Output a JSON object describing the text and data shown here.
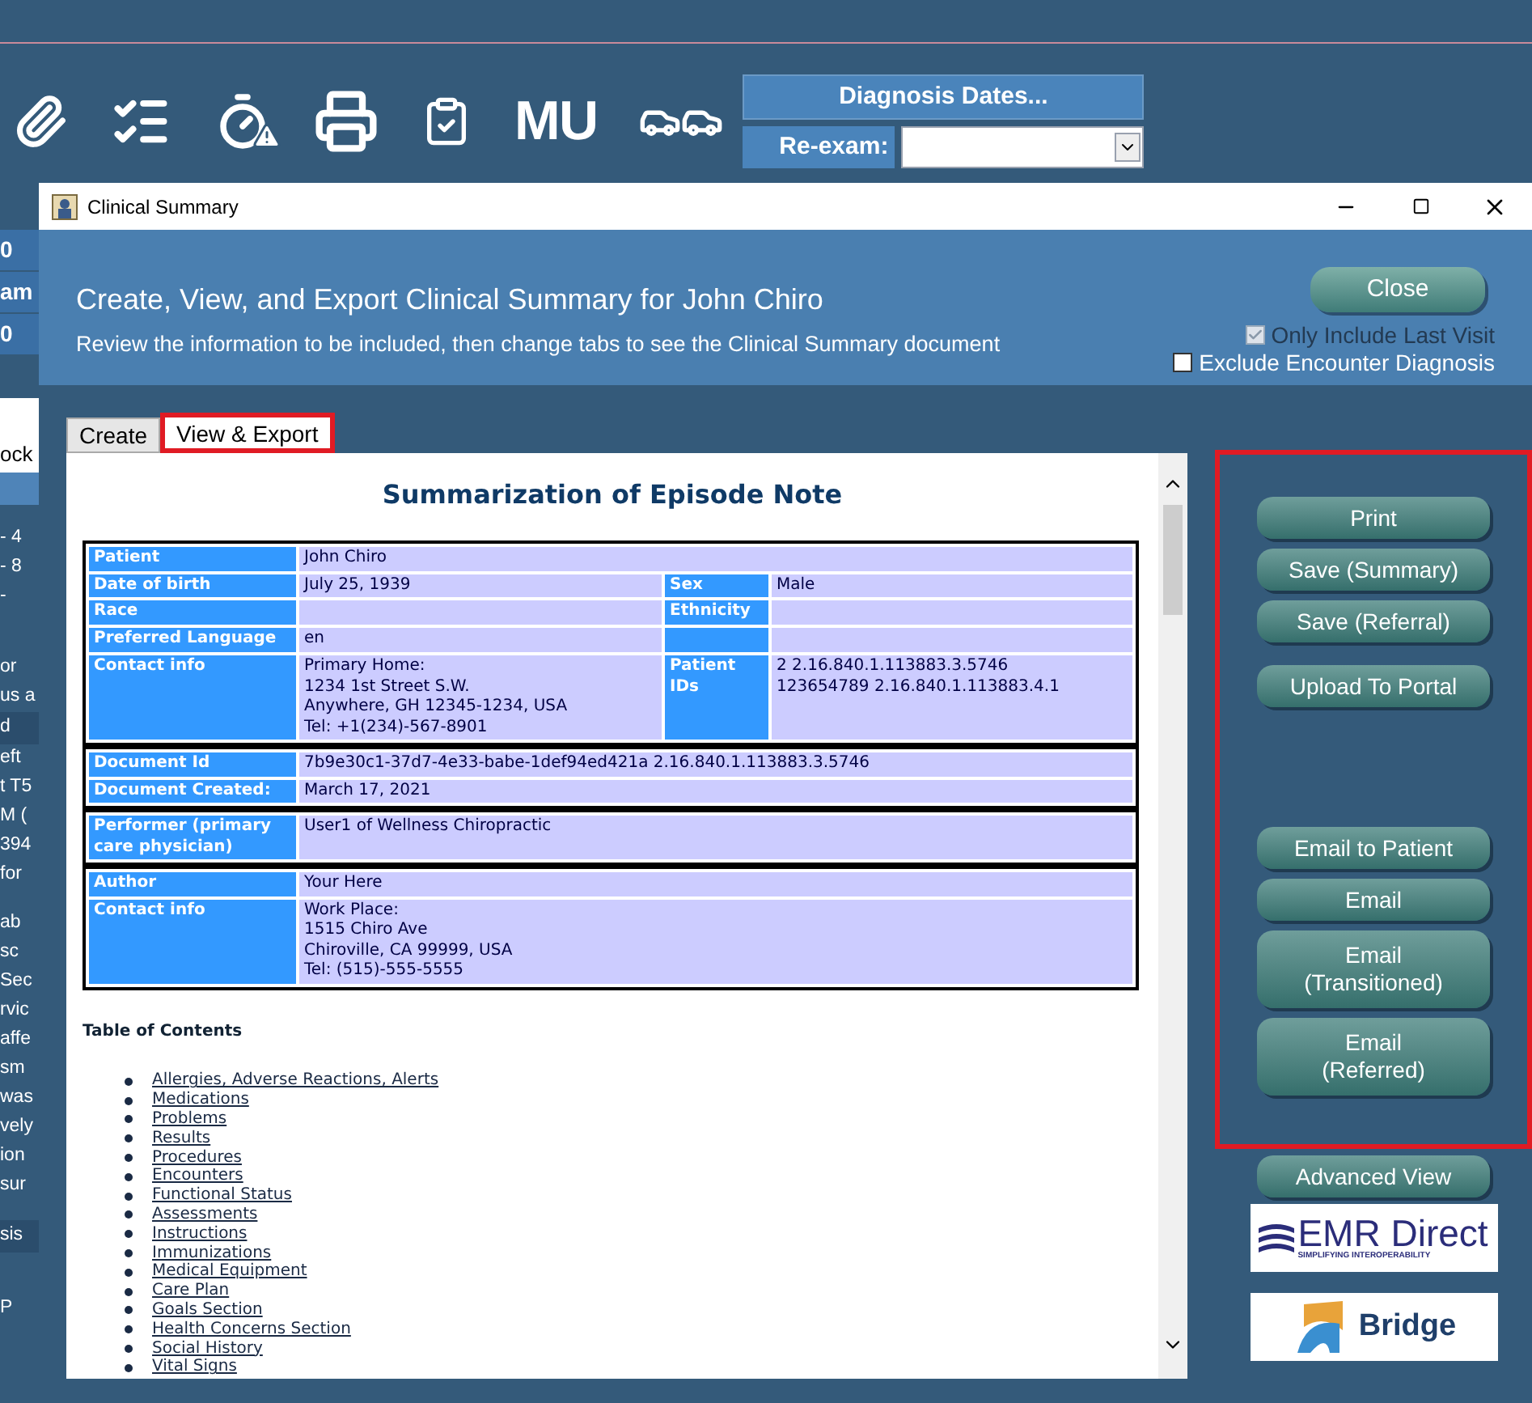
{
  "toolbar": {
    "tools": [
      {
        "kind": "paperclip"
      },
      {
        "kind": "checklist"
      },
      {
        "kind": "stopwatch"
      },
      {
        "kind": "printer"
      },
      {
        "kind": "clipboard"
      },
      {
        "kind": "text",
        "label": "MU"
      },
      {
        "kind": "cars"
      }
    ],
    "diagnosis_button": "Diagnosis Dates...",
    "reexam_label": "Re-exam:"
  },
  "background_strip": [
    {
      "kind": "head",
      "text": "0"
    },
    {
      "kind": "head",
      "text": "am"
    },
    {
      "kind": "head",
      "text": "0"
    },
    {
      "kind": "gap"
    },
    {
      "kind": "field"
    },
    {
      "kind": "row",
      "text": "ock"
    },
    {
      "kind": "band"
    },
    {
      "kind": "gap-sm"
    },
    {
      "kind": "line",
      "text": "- 4"
    },
    {
      "kind": "line",
      "text": "- 8"
    },
    {
      "kind": "line",
      "text": "-"
    },
    {
      "kind": "gap"
    },
    {
      "kind": "line",
      "text": "or"
    },
    {
      "kind": "line",
      "text": "us a"
    },
    {
      "kind": "dark",
      "text": "d"
    },
    {
      "kind": "line",
      "text": "eft"
    },
    {
      "kind": "line",
      "text": "t T5"
    },
    {
      "kind": "line",
      "text": "M ("
    },
    {
      "kind": "line",
      "text": "394"
    },
    {
      "kind": "line",
      "text": "for"
    },
    {
      "kind": "gap-sm"
    },
    {
      "kind": "line",
      "text": "ab"
    },
    {
      "kind": "line",
      "text": "sc"
    },
    {
      "kind": "line",
      "text": "Sec"
    },
    {
      "kind": "line",
      "text": "rvic"
    },
    {
      "kind": "line",
      "text": "affe"
    },
    {
      "kind": "line",
      "text": "sm"
    },
    {
      "kind": "line",
      "text": "was"
    },
    {
      "kind": "line",
      "text": "vely"
    },
    {
      "kind": "line",
      "text": "ion"
    },
    {
      "kind": "line",
      "text": "sur"
    },
    {
      "kind": "gap-sm"
    },
    {
      "kind": "dark",
      "text": "sis"
    },
    {
      "kind": "gap"
    },
    {
      "kind": "line",
      "text": "P"
    }
  ],
  "window": {
    "title": "Clinical Summary"
  },
  "header": {
    "title": "Create, View, and Export Clinical Summary for John Chiro",
    "subtitle": "Review the information to be included, then change tabs to see the Clinical Summary document",
    "close_button": "Close",
    "options": [
      {
        "label": "Only Include Last Visit",
        "checked": true,
        "disabled": true
      },
      {
        "label": "Exclude Encounter Diagnosis",
        "checked": false,
        "disabled": false
      }
    ]
  },
  "tabs": [
    {
      "label": "Create",
      "selected": false,
      "highlighted": false
    },
    {
      "label": "View & Export",
      "selected": true,
      "highlighted": true
    }
  ],
  "document": {
    "title": "Summarization of Episode Note",
    "sections": [
      {
        "rows": [
          [
            {
              "kind": "label",
              "lines": [
                "Patient"
              ]
            },
            {
              "kind": "value",
              "colspan": 3,
              "lines": [
                "John Chiro"
              ]
            }
          ],
          [
            {
              "kind": "label",
              "lines": [
                "Date of birth"
              ]
            },
            {
              "kind": "value",
              "lines": [
                "July 25, 1939"
              ]
            },
            {
              "kind": "label",
              "lines": [
                "Sex"
              ]
            },
            {
              "kind": "value",
              "lines": [
                "Male"
              ]
            }
          ],
          [
            {
              "kind": "label",
              "lines": [
                "Race"
              ]
            },
            {
              "kind": "value"
            },
            {
              "kind": "label",
              "lines": [
                "Ethnicity"
              ]
            },
            {
              "kind": "value"
            }
          ],
          [
            {
              "kind": "label",
              "lines": [
                "Preferred Language"
              ]
            },
            {
              "kind": "value",
              "lines": [
                "en"
              ]
            },
            {
              "kind": "label"
            },
            {
              "kind": "value"
            }
          ],
          [
            {
              "kind": "label",
              "lines": [
                "Contact info"
              ]
            },
            {
              "kind": "value",
              "lines": [
                "Primary Home:",
                "1234 1st Street S.W.",
                "Anywhere, GH 12345-1234, USA",
                "Tel: +1(234)-567-8901"
              ]
            },
            {
              "kind": "label",
              "lines": [
                "Patient",
                "IDs"
              ]
            },
            {
              "kind": "value",
              "lines": [
                "2 2.16.840.1.113883.3.5746",
                "123654789 2.16.840.1.113883.4.1"
              ]
            }
          ]
        ]
      },
      {
        "rows": [
          [
            {
              "kind": "label",
              "lines": [
                "Document Id"
              ]
            },
            {
              "kind": "value",
              "colspan": 3,
              "lines": [
                "7b9e30c1-37d7-4e33-babe-1def94ed421a 2.16.840.1.113883.3.5746"
              ]
            }
          ],
          [
            {
              "kind": "label",
              "lines": [
                "Document Created:"
              ]
            },
            {
              "kind": "value",
              "colspan": 3,
              "lines": [
                "March 17, 2021"
              ]
            }
          ]
        ]
      },
      {
        "rows": [
          [
            {
              "kind": "label",
              "lines": [
                "Performer (primary",
                "care physician)"
              ]
            },
            {
              "kind": "value",
              "colspan": 3,
              "lines": [
                "User1 of Wellness Chiropractic"
              ]
            }
          ]
        ]
      },
      {
        "rows": [
          [
            {
              "kind": "label",
              "lines": [
                "Author"
              ]
            },
            {
              "kind": "value",
              "colspan": 3,
              "lines": [
                "Your Here"
              ]
            }
          ],
          [
            {
              "kind": "label",
              "lines": [
                "Contact info"
              ]
            },
            {
              "kind": "value",
              "colspan": 3,
              "lines": [
                "Work Place:",
                "1515 Chiro Ave",
                "Chiroville, CA 99999, USA",
                "Tel: (515)-555-5555"
              ]
            }
          ]
        ]
      }
    ],
    "toc_title": "Table of Contents",
    "toc": [
      "Allergies, Adverse Reactions, Alerts",
      "Medications",
      "Problems",
      "Results",
      "Procedures",
      "Encounters",
      "Functional Status",
      "Assessments",
      "Instructions",
      "Immunizations",
      "Medical Equipment",
      "Care Plan",
      "Goals Section",
      "Health Concerns Section",
      "Social History",
      "Vital Signs"
    ]
  },
  "actions": {
    "highlighted": true,
    "groups": [
      [
        {
          "lines": [
            "Print"
          ]
        },
        {
          "lines": [
            "Save (Summary)"
          ]
        },
        {
          "lines": [
            "Save (Referral)"
          ]
        }
      ],
      [
        {
          "lines": [
            "Upload To Portal"
          ]
        }
      ],
      [
        {
          "lines": [
            "Email to Patient"
          ]
        },
        {
          "lines": [
            "Email"
          ]
        },
        {
          "lines": [
            "Email",
            "(Transitioned)"
          ]
        },
        {
          "lines": [
            "Email",
            "(Referred)"
          ]
        }
      ]
    ]
  },
  "advanced_button": "Advanced  View",
  "logos": [
    {
      "kind": "emr",
      "name": "EMR Direct",
      "tagline": "SIMPLIFYING INTEROPERABILITY"
    },
    {
      "kind": "bridge",
      "name": "Bridge"
    }
  ]
}
